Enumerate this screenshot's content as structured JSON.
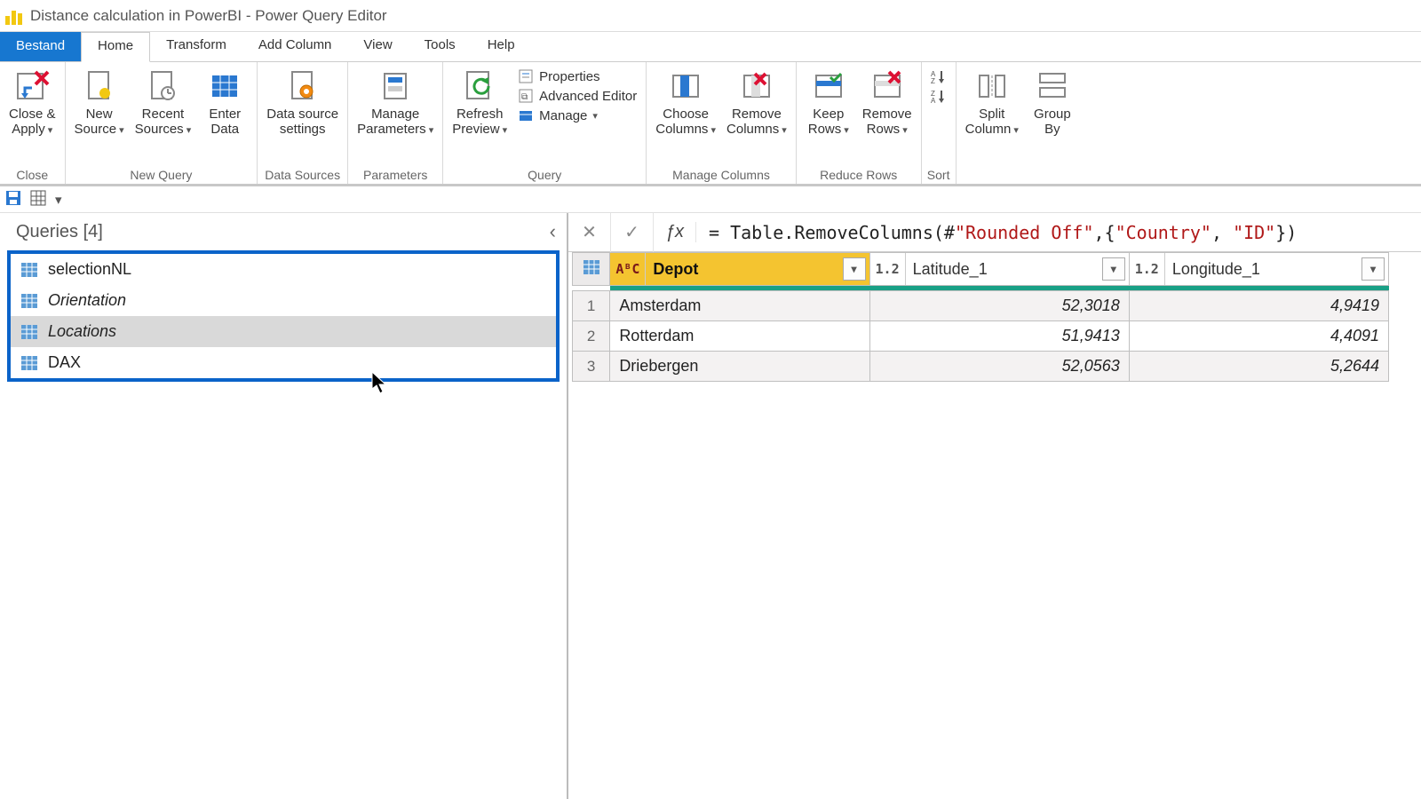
{
  "window": {
    "title": "Distance calculation in PowerBI - Power Query Editor"
  },
  "tabs": {
    "file": "Bestand",
    "items": [
      "Home",
      "Transform",
      "Add Column",
      "View",
      "Tools",
      "Help"
    ],
    "active": "Home"
  },
  "ribbon": {
    "close": {
      "close_apply": "Close &\nApply",
      "group": "Close"
    },
    "new_query": {
      "new_source": "New\nSource",
      "recent_sources": "Recent\nSources",
      "enter_data": "Enter\nData",
      "group": "New Query"
    },
    "data_sources": {
      "settings": "Data source\nsettings",
      "group": "Data Sources"
    },
    "parameters": {
      "manage": "Manage\nParameters",
      "group": "Parameters"
    },
    "query": {
      "refresh": "Refresh\nPreview",
      "properties": "Properties",
      "adv_editor": "Advanced Editor",
      "manage": "Manage",
      "group": "Query"
    },
    "manage_cols": {
      "choose": "Choose\nColumns",
      "remove": "Remove\nColumns",
      "group": "Manage Columns"
    },
    "reduce_rows": {
      "keep": "Keep\nRows",
      "remove": "Remove\nRows",
      "group": "Reduce Rows"
    },
    "sort": {
      "group": "Sort"
    },
    "split": {
      "split": "Split\nColumn",
      "group_by": "Group\nBy"
    }
  },
  "queries": {
    "title": "Queries [4]",
    "items": [
      {
        "name": "selectionNL",
        "italic": false,
        "selected": false
      },
      {
        "name": "Orientation",
        "italic": true,
        "selected": false
      },
      {
        "name": "Locations",
        "italic": true,
        "selected": true
      },
      {
        "name": "DAX",
        "italic": false,
        "selected": false
      }
    ]
  },
  "formula": {
    "prefix": "= Table.RemoveColumns(#",
    "arg1": "\"Rounded Off\"",
    "mid": ",{",
    "arg2": "\"Country\"",
    "sep": ", ",
    "arg3": "\"ID\"",
    "suffix": "})"
  },
  "grid": {
    "columns": [
      {
        "type": "AᴮC",
        "name": "Depot",
        "selected": true,
        "kind": "text"
      },
      {
        "type": "1.2",
        "name": "Latitude_1",
        "selected": false,
        "kind": "num"
      },
      {
        "type": "1.2",
        "name": "Longitude_1",
        "selected": false,
        "kind": "num"
      }
    ],
    "rows": [
      {
        "n": "1",
        "cells": [
          "Amsterdam",
          "52,3018",
          "4,9419"
        ]
      },
      {
        "n": "2",
        "cells": [
          "Rotterdam",
          "51,9413",
          "4,4091"
        ]
      },
      {
        "n": "3",
        "cells": [
          "Driebergen",
          "52,0563",
          "5,2644"
        ]
      }
    ]
  }
}
